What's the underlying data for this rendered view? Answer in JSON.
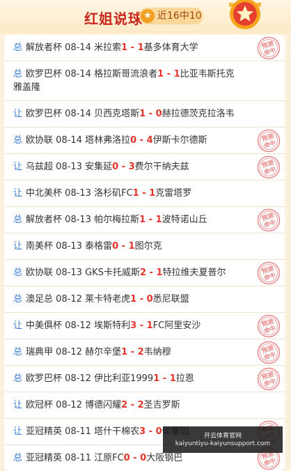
{
  "header": {
    "title": "红姐说球",
    "badge": "近16中10"
  },
  "matches": [
    {
      "type": "总",
      "league": "解放者杯",
      "date": "08-14",
      "home": "米拉索",
      "hs": "1",
      "as": "1",
      "away": "基多体育大学",
      "hit": true
    },
    {
      "type": "总",
      "league": "欧罗巴杯",
      "date": "08-14",
      "home": "格拉斯哥流浪者",
      "hs": "1",
      "as": "1",
      "away": "比亚韦斯托克雅盖隆",
      "hit": false
    },
    {
      "type": "让",
      "league": "欧罗巴杯",
      "date": "08-14",
      "home": "贝西克塔斯",
      "hs": "1",
      "as": "0",
      "away": "赫拉德茨克拉洛韦",
      "hit": false
    },
    {
      "type": "总",
      "league": "欧协联",
      "date": "08-14",
      "home": "塔林弗洛拉",
      "hs": "0",
      "as": "4",
      "away": "伊斯卡尔德斯",
      "hit": true
    },
    {
      "type": "让",
      "league": "乌兹超",
      "date": "08-13",
      "home": "安集延",
      "hs": "0",
      "as": "3",
      "away": "费尔干纳夫兹",
      "hit": true
    },
    {
      "type": "让",
      "league": "中北美杯",
      "date": "08-13",
      "home": "洛杉矶FC",
      "hs": "1",
      "as": "1",
      "away": "克雷塔罗",
      "hit": false
    },
    {
      "type": "总",
      "league": "解放者杯",
      "date": "08-13",
      "home": "帕尔梅拉斯",
      "hs": "1",
      "as": "1",
      "away": "波特诺山丘",
      "hit": true
    },
    {
      "type": "让",
      "league": "南美杯",
      "date": "08-13",
      "home": "泰格雷",
      "hs": "0",
      "as": "1",
      "away": "图尔克",
      "hit": false
    },
    {
      "type": "总",
      "league": "欧协联",
      "date": "08-13",
      "home": "GKS卡托威斯",
      "hs": "2",
      "as": "1",
      "away": "特拉维夫夏普尔",
      "hit": true
    },
    {
      "type": "总",
      "league": "澳足总",
      "date": "08-12",
      "home": "莱卡特老虎",
      "hs": "1",
      "as": "0",
      "away": "悉尼联盟",
      "hit": false
    },
    {
      "type": "让",
      "league": "中美俱杯",
      "date": "08-12",
      "home": "埃斯特利",
      "hs": "3",
      "as": "1",
      "away": "FC阿里安沙",
      "hit": true
    },
    {
      "type": "总",
      "league": "瑞典甲",
      "date": "08-12",
      "home": "赫尔辛堡",
      "hs": "1",
      "as": "2",
      "away": "韦纳穆",
      "hit": true
    },
    {
      "type": "总",
      "league": "欧罗巴杯",
      "date": "08-12",
      "home": "伊比利亚1999",
      "hs": "1",
      "as": "1",
      "away": "拉恩",
      "hit": true
    },
    {
      "type": "让",
      "league": "欧冠杯",
      "date": "08-12",
      "home": "博德闪耀",
      "hs": "2",
      "as": "2",
      "away": "圣吉罗斯",
      "hit": false
    },
    {
      "type": "让",
      "league": "亚冠精英",
      "date": "08-11",
      "home": "塔什干棉农",
      "hs": "3",
      "as": "0",
      "away": "侯塞因",
      "hit": true
    },
    {
      "type": "总",
      "league": "亚冠精英",
      "date": "08-11",
      "home": "江原FC",
      "hs": "0",
      "as": "0",
      "away": "大阪钢巴",
      "hit": true
    }
  ],
  "stamp": {
    "line1": "预测",
    "line2": "命中"
  },
  "overlay": {
    "line1": "开云体育官网",
    "line2": "kaiyuntiyu-kaiyunsupport.com"
  },
  "colors": {
    "accent": "#e5332a",
    "type": "#3a7bd5",
    "stamp": "#e88a8a"
  }
}
